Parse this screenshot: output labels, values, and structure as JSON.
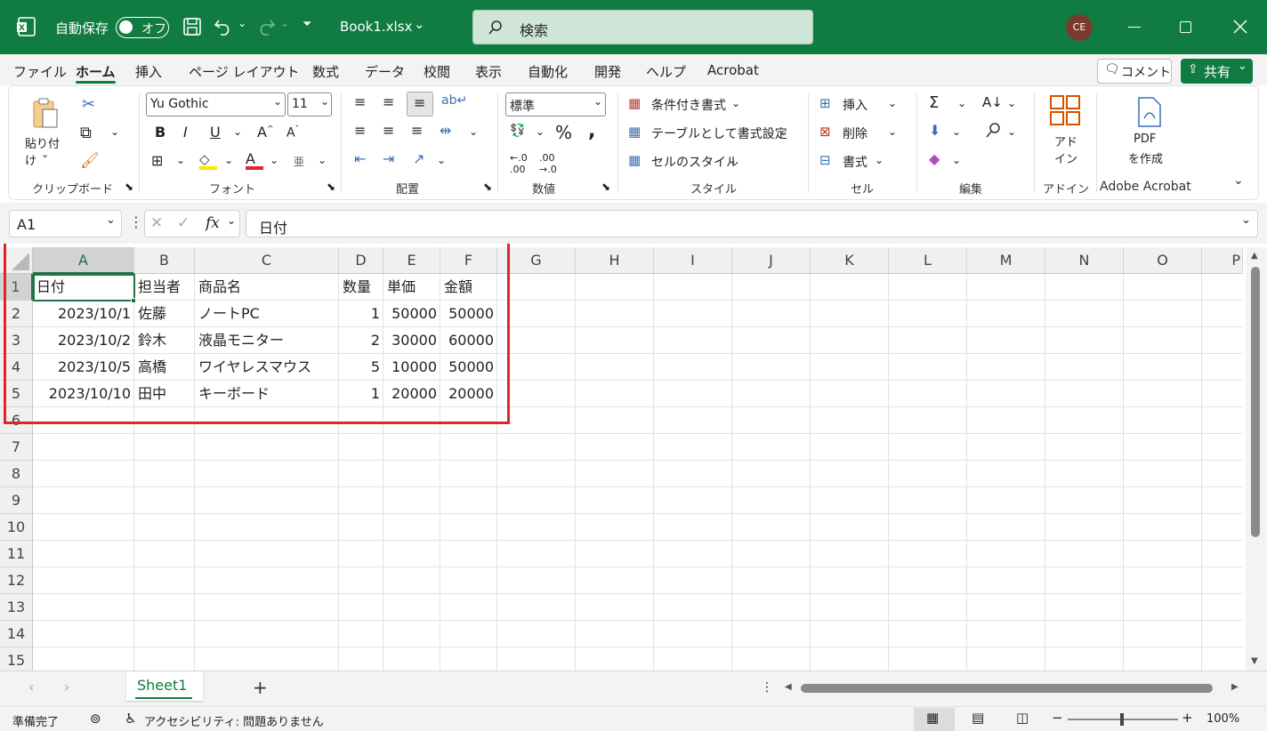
{
  "titlebar": {
    "autosave_label": "自動保存",
    "autosave_state": "オフ",
    "filename": "Book1.xlsx",
    "search_placeholder": "検索",
    "avatar_initials": "CE"
  },
  "menu": [
    "ファイル",
    "ホーム",
    "挿入",
    "ページ レイアウト",
    "数式",
    "データ",
    "校閲",
    "表示",
    "自動化",
    "開発",
    "ヘルプ",
    "Acrobat"
  ],
  "menu_active": "ホーム",
  "menu_right": {
    "comment": "コメント",
    "share": "共有"
  },
  "ribbon": {
    "clipboard": {
      "paste": "貼り付け",
      "label": "クリップボード"
    },
    "font": {
      "name": "Yu Gothic",
      "size": "11",
      "label": "フォント"
    },
    "alignment": {
      "label": "配置"
    },
    "number": {
      "format": "標準",
      "label": "数値"
    },
    "styles": {
      "conditional": "条件付き書式",
      "table": "テーブルとして書式設定",
      "cell_styles": "セルのスタイル",
      "label": "スタイル"
    },
    "cells": {
      "insert": "挿入",
      "delete": "削除",
      "format": "書式",
      "label": "セル"
    },
    "editing": {
      "label": "編集"
    },
    "addins": {
      "btn_line1": "アド",
      "btn_line2": "イン",
      "label": "アドイン"
    },
    "acrobat": {
      "btn_line1": "PDF",
      "btn_line2": "を作成",
      "label": "Adobe Acrobat"
    }
  },
  "formula_bar": {
    "name_box": "A1",
    "fx": "fx",
    "content": "日付"
  },
  "columns": [
    "A",
    "B",
    "C",
    "D",
    "E",
    "F",
    "G",
    "H",
    "I",
    "J",
    "K",
    "L",
    "M",
    "N",
    "O",
    "P"
  ],
  "rows": [
    "1",
    "2",
    "3",
    "4",
    "5",
    "6",
    "7",
    "8",
    "9",
    "10",
    "11",
    "12",
    "13",
    "14",
    "15"
  ],
  "table": {
    "headers": [
      "日付",
      "担当者",
      "商品名",
      "数量",
      "単価",
      "金額"
    ],
    "rows": [
      [
        "2023/10/1",
        "佐藤",
        "ノートPC",
        "1",
        "50000",
        "50000"
      ],
      [
        "2023/10/2",
        "鈴木",
        "液晶モニター",
        "2",
        "30000",
        "60000"
      ],
      [
        "2023/10/5",
        "高橋",
        "ワイヤレスマウス",
        "5",
        "10000",
        "50000"
      ],
      [
        "2023/10/10",
        "田中",
        "キーボード",
        "1",
        "20000",
        "20000"
      ]
    ]
  },
  "sheet_tab": "Sheet1",
  "status": {
    "ready": "準備完了",
    "accessibility": "アクセシビリティ: 問題ありません",
    "zoom": "100%"
  },
  "colors": {
    "excel_green": "#107c41",
    "highlight_red": "#e0262c",
    "selection_green": "#217346"
  }
}
